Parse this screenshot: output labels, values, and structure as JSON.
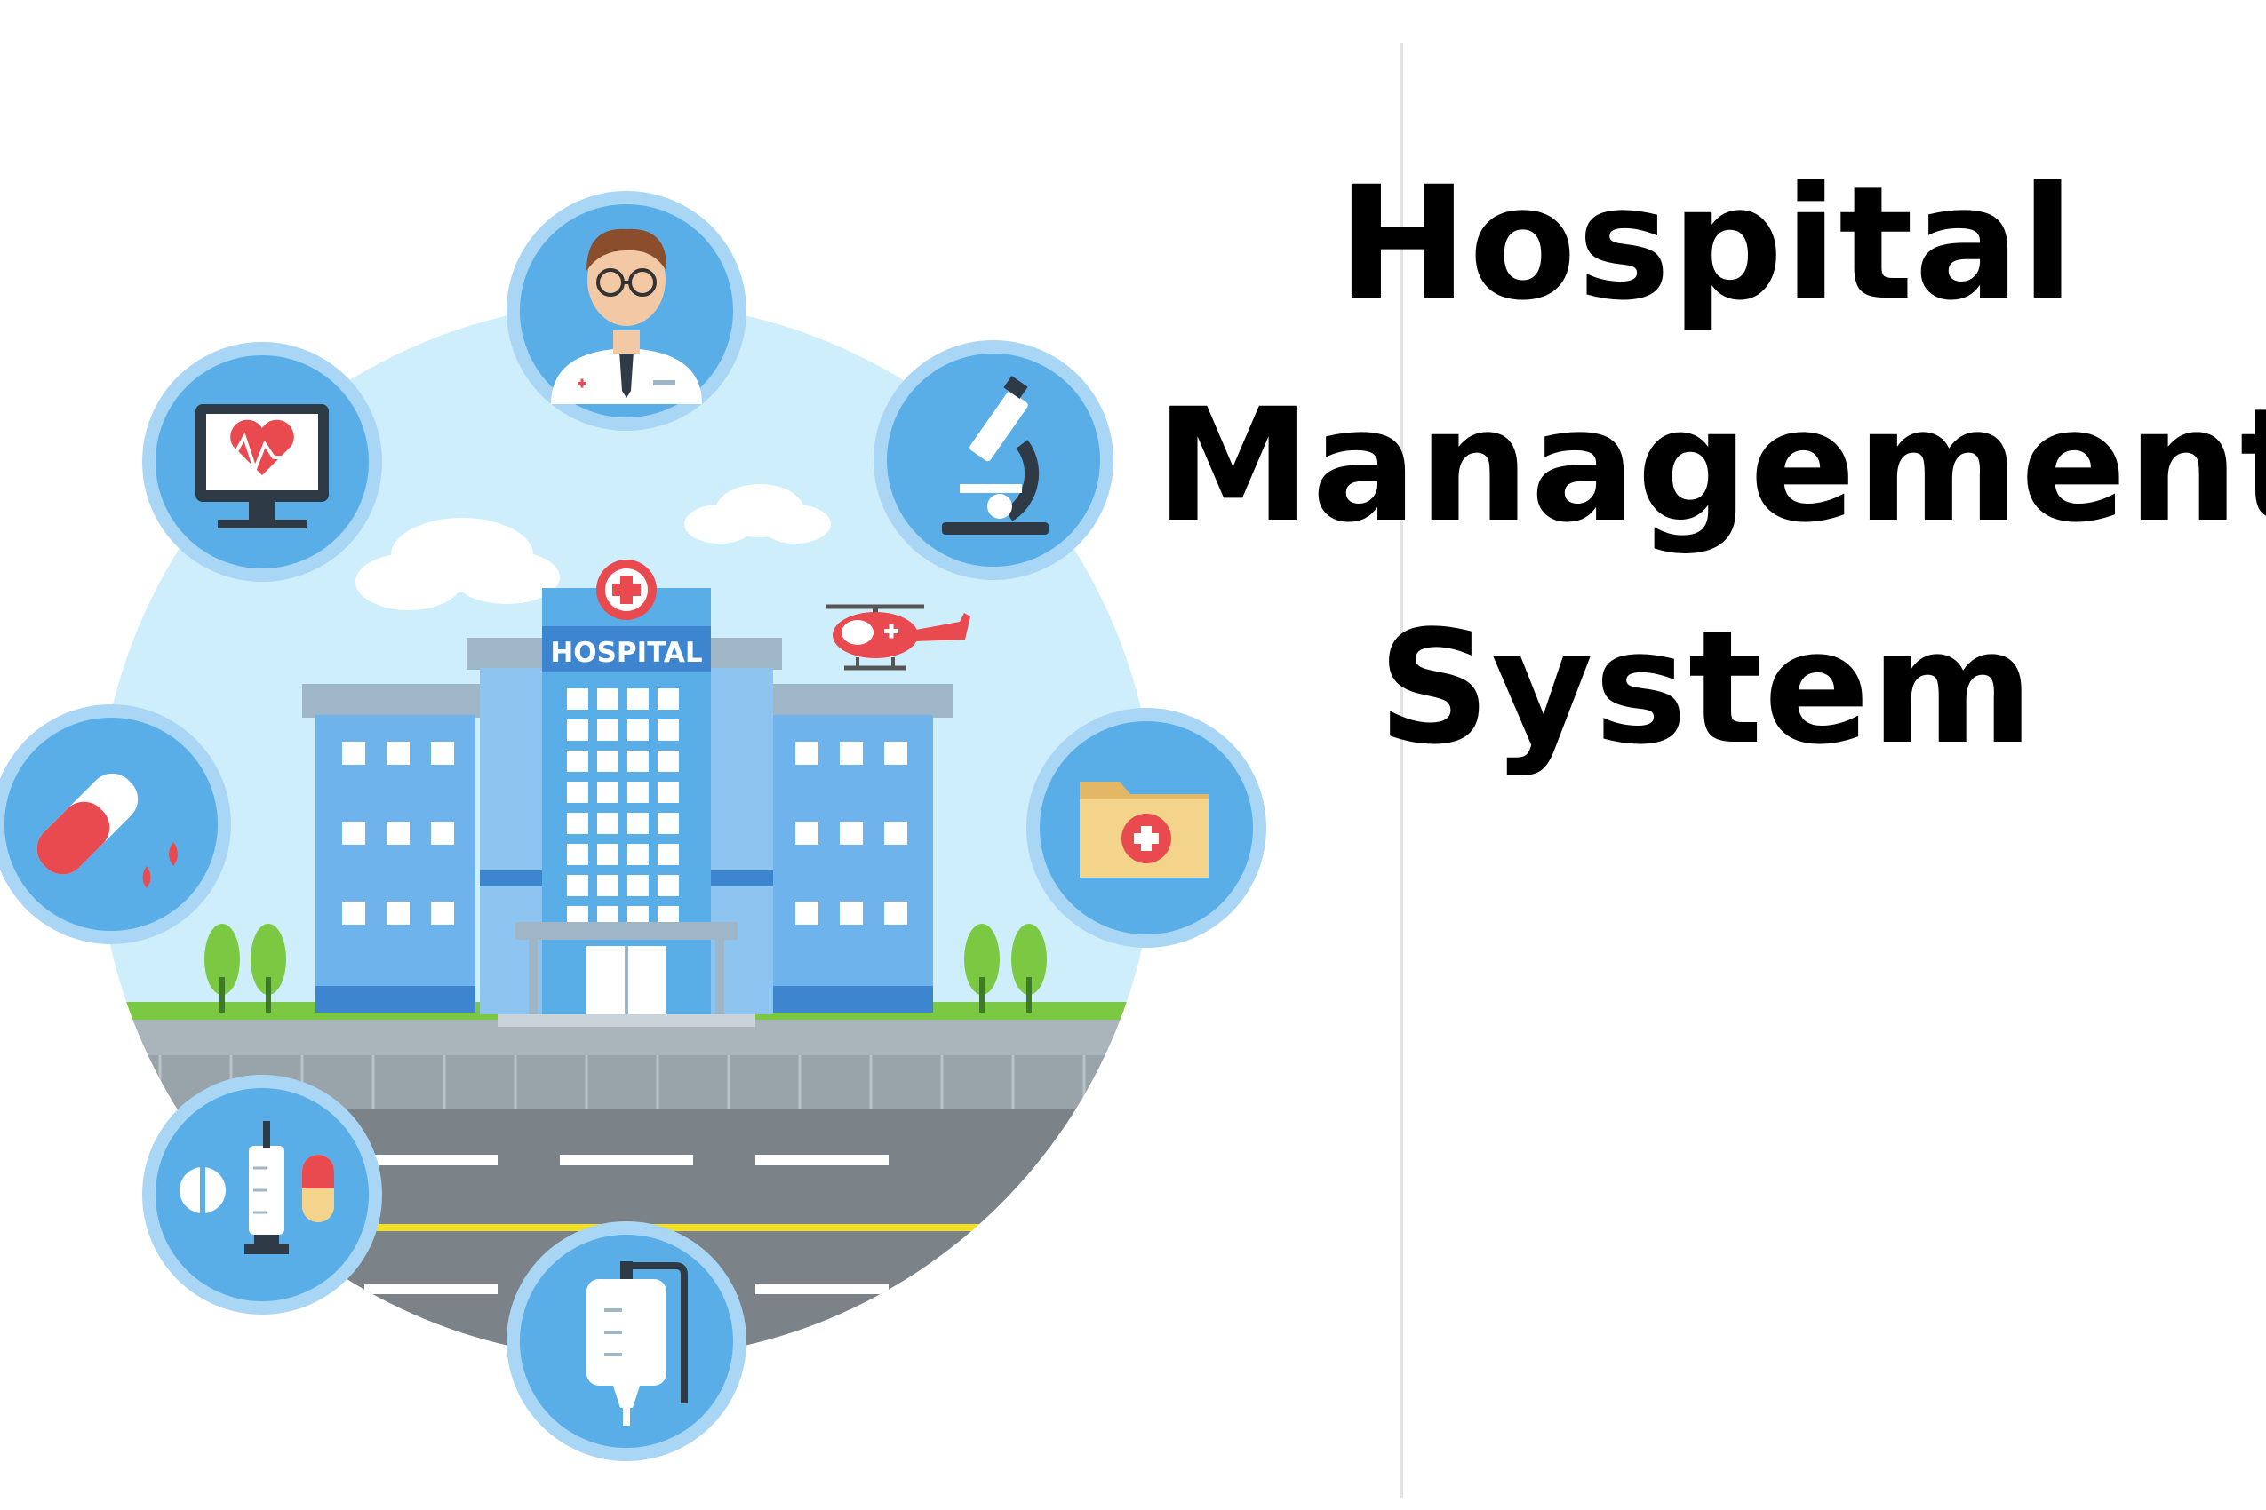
{
  "title": {
    "line1": "Hospital",
    "line2": "Management",
    "line3": "System"
  },
  "illustration": {
    "building_sign": "HOSPITAL",
    "icons": [
      "doctor-icon",
      "heart-monitor-icon",
      "microscope-icon",
      "test-tube-icon",
      "medical-folder-icon",
      "medicine-icon",
      "iv-bag-icon",
      "helicopter-icon"
    ]
  },
  "colors": {
    "sky": "#cdeefa",
    "badge": "#5aaee8",
    "badge_ring": "#a9d6f4",
    "building": "#6fb3ec",
    "building_dark": "#3d86cf",
    "window": "#ffffff",
    "road": "#7b8288",
    "grass": "#7bc943",
    "accent_red": "#e84a4f",
    "folder": "#f4d48a",
    "text": "#000000"
  }
}
